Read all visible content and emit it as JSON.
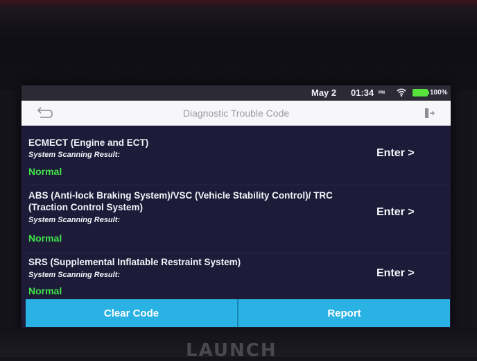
{
  "status_bar": {
    "date": "May 2",
    "time": "01:34",
    "ampm": "PM",
    "battery_percent": "100%",
    "battery_color": "#58e33c"
  },
  "title_bar": {
    "title": "Diagnostic Trouble Code",
    "back_icon": "back-arrow-icon",
    "exit_icon": "exit-icon"
  },
  "systems": [
    {
      "name": "ECMECT (Engine and ECT)",
      "result_label": "System Scanning Result:",
      "result": "Normal",
      "enter_label": "Enter >"
    },
    {
      "name": "ABS (Anti-lock Braking System)/VSC (Vehicle Stability Control)/ TRC (Traction Control System)",
      "result_label": "System Scanning Result:",
      "result": "Normal",
      "enter_label": "Enter >"
    },
    {
      "name": "SRS (Supplemental Inflatable Restraint System)",
      "result_label": "System Scanning Result:",
      "result": "Normal",
      "enter_label": "Enter >"
    }
  ],
  "actions": {
    "clear_code": "Clear Code",
    "report": "Report"
  },
  "device": {
    "brand": "LAUNCH"
  },
  "colors": {
    "accent": "#2ab2e4",
    "status_normal": "#3fe34a",
    "screen_bg": "#1d1b38"
  }
}
